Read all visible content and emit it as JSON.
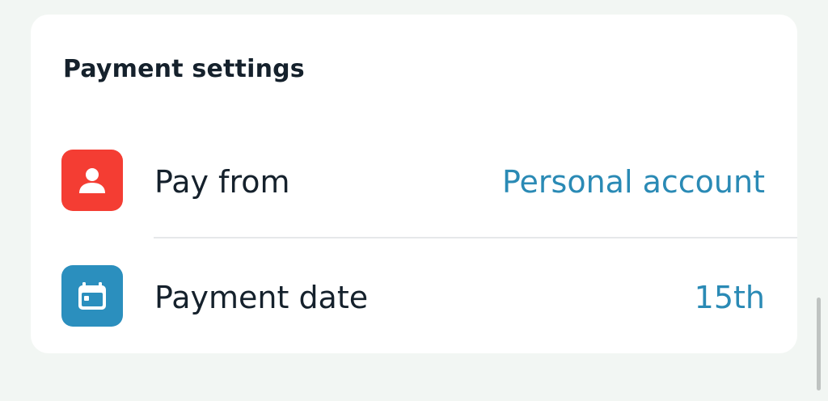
{
  "settings_card": {
    "title": "Payment settings",
    "rows": [
      {
        "label": "Pay from",
        "value": "Personal account",
        "icon": "person-icon",
        "icon_color": "#f43d33"
      },
      {
        "label": "Payment date",
        "value": "15th",
        "icon": "calendar-icon",
        "icon_color": "#2b8fbe"
      }
    ]
  },
  "colors": {
    "background": "#f2f6f3",
    "card": "#ffffff",
    "text": "#15212c",
    "accent_value": "#2a8ab5"
  }
}
